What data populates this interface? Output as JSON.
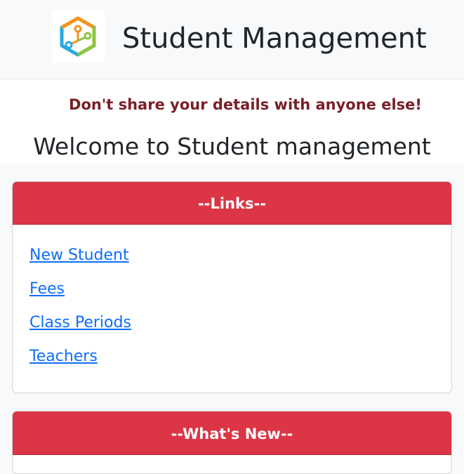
{
  "header": {
    "brand": "Student Management",
    "logo_icon": "cube-network-icon"
  },
  "intro": {
    "warning": "Don't share your details with anyone else!",
    "welcome": "Welcome to Student management"
  },
  "links_card": {
    "title": "--Links--",
    "items": [
      {
        "label": "New Student"
      },
      {
        "label": "Fees"
      },
      {
        "label": "Class Periods"
      },
      {
        "label": "Teachers"
      }
    ]
  },
  "news_card": {
    "title": "--What's New--"
  },
  "colors": {
    "card_header_bg": "#dc3545",
    "link": "#0d6efd",
    "warning_text": "#7a1f27",
    "navbar_bg": "#f8f9fa"
  }
}
